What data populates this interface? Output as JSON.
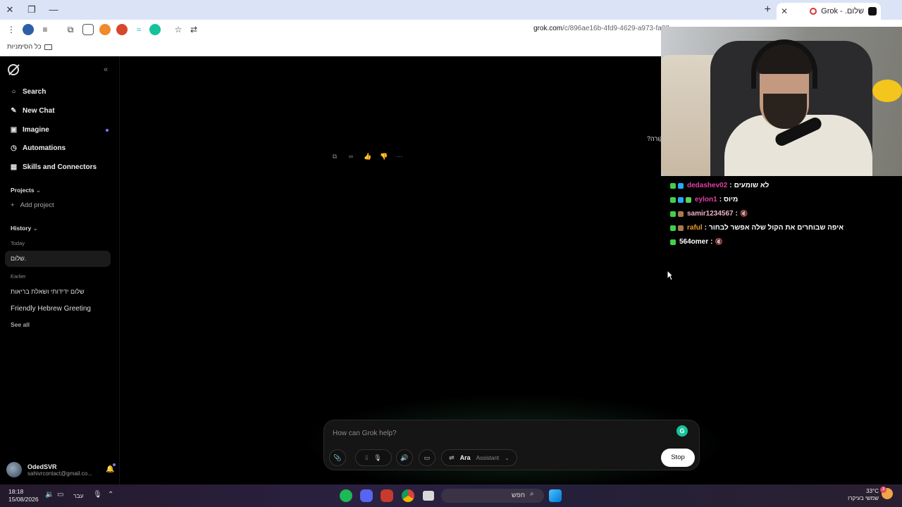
{
  "browser": {
    "tab_title": "שלום. - Grok",
    "url_host": "grok.com",
    "url_path": "/c/896ae16b-4fd9-4629-a973-fa23",
    "bookmarks_all": "כל הסימניות"
  },
  "sidebar": {
    "collapse_glyph": "«",
    "nav": [
      {
        "label": "Search",
        "icon": "search-icon"
      },
      {
        "label": "New Chat",
        "icon": "edit-icon"
      },
      {
        "label": "Imagine",
        "icon": "image-icon"
      },
      {
        "label": "Automations",
        "icon": "clock-icon"
      },
      {
        "label": "Skills and Connectors",
        "icon": "grid-icon"
      }
    ],
    "projects_title": "Projects",
    "add_project": "Add project",
    "history_title": "History",
    "today_label": "Today",
    "today_items": [
      "שלום."
    ],
    "earlier_label": "Earlier",
    "earlier_items": [
      "שלום ידידותי ושאלת בריאות",
      "Friendly Hebrew Greeting"
    ],
    "see_all": "See all",
    "user_name": "OdedSVR",
    "user_email": "sahivrcontact@gmail.co..."
  },
  "main": {
    "rtl_fragment": "?קורה",
    "composer_placeholder": "How can Grok help?",
    "voice_name": "Ara",
    "voice_role": "Assistant",
    "stop_label": "Stop"
  },
  "chat": [
    {
      "user": "dedashev02",
      "color": "#e03fa6",
      "message": "לא שומעים",
      "badges": [
        "k",
        "b"
      ]
    },
    {
      "user": "eylon1",
      "color": "#e03fa6",
      "message": "מיוס",
      "badges": [
        "k",
        "b",
        "g"
      ]
    },
    {
      "user": "samir1234567",
      "color": "#f1b2c8",
      "message": "🔇",
      "badges": [
        "k",
        "p"
      ]
    },
    {
      "user": "raful",
      "color": "#e69b2c",
      "message": "איפה שבוחרים את הקול שלה אפשר לבחור",
      "badges": [
        "k",
        "p"
      ]
    },
    {
      "user": "564omer",
      "color": "#ffffff",
      "message": "🔇",
      "badges": [
        "k"
      ]
    }
  ],
  "taskbar": {
    "time": "18:18",
    "date": "15/08/2026",
    "lang": "עבר",
    "search_text": "חפש",
    "temp": "33°C",
    "weather_desc": "שמשי בעיקרו",
    "weather_badge": "3"
  }
}
